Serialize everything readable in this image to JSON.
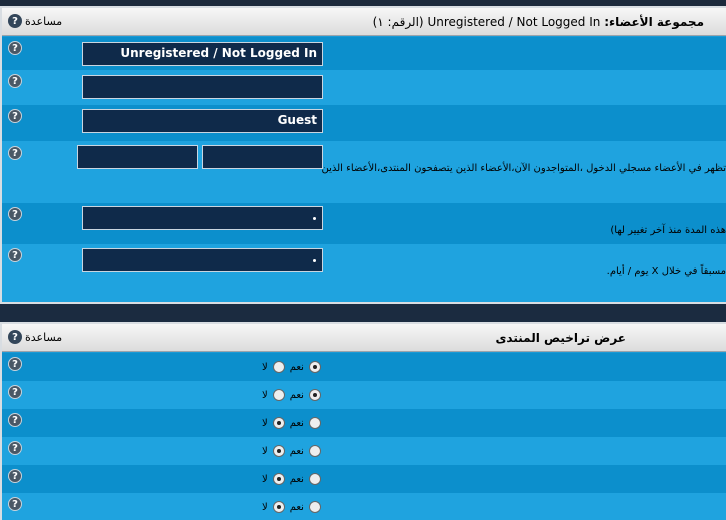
{
  "group_panel": {
    "title_prefix": "مجموعة الأعضاء:",
    "title_name": "Unregistered / Not Logged In",
    "title_id": "(الرقم: ١)",
    "help_label": "مساعدة",
    "fields": {
      "group_title": "Unregistered / Not Logged In",
      "description": "",
      "user_title": "Guest",
      "open_tag": "",
      "close_tag": ""
    },
    "desc_markup": "تظهر في الأعضاء مسجلي الدخول ،المتواجدون الآن،الأعضاء الذين يتصفحون المنتدى،الأعضاء الذين",
    "desc_period": "هذه المدة منذ آخر تغيير لها)",
    "desc_days": "مسبقاً في خلال X يوم / أيام."
  },
  "perm_panel": {
    "title": "عرض تراخيص المنتدى",
    "help_label": "مساعدة",
    "yes_label": "نعم",
    "no_label": "لا",
    "rows": [
      {
        "yes": true
      },
      {
        "yes": true
      },
      {
        "yes": false
      },
      {
        "yes": false
      },
      {
        "yes": false
      },
      {
        "yes": false
      }
    ]
  }
}
